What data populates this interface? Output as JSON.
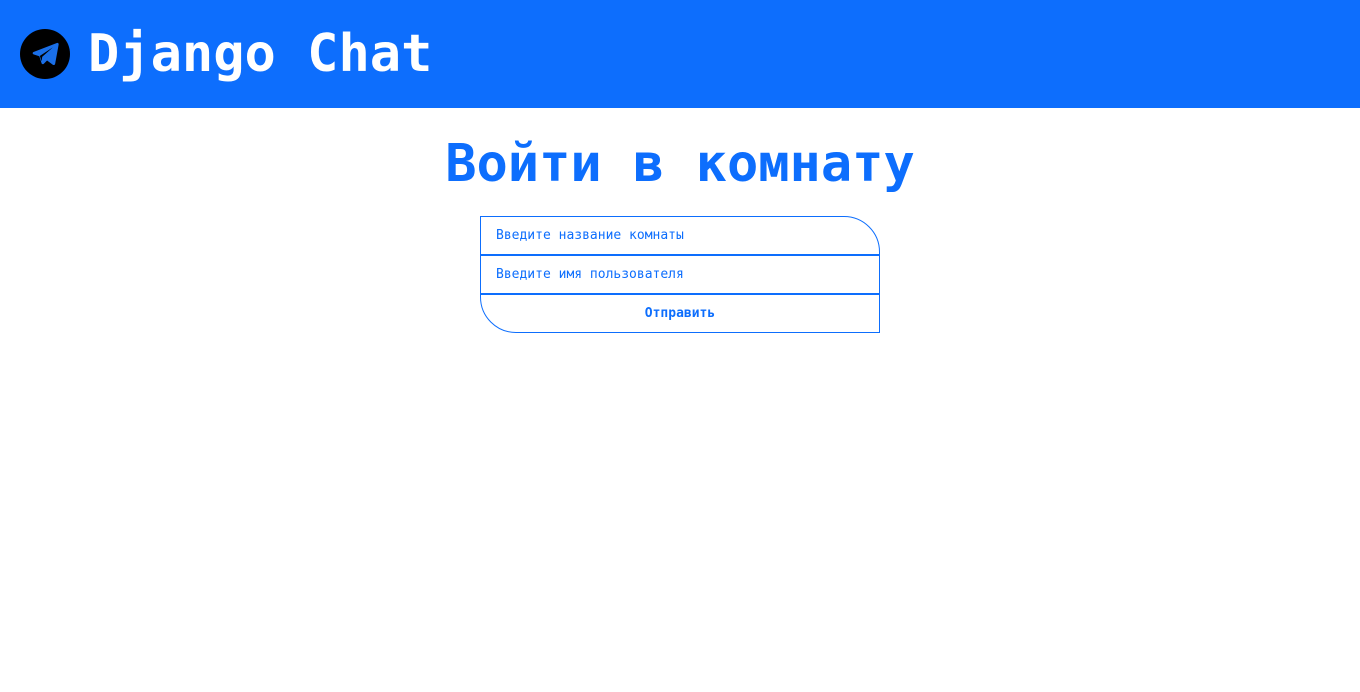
{
  "header": {
    "app_title": "Django Chat",
    "logo_icon": "telegram-send-icon",
    "background_color": "#0d6efd"
  },
  "main": {
    "page_title": "Войти в комнату",
    "form": {
      "room_placeholder": "Введите название комнаты",
      "room_value": "",
      "username_placeholder": "Введите имя пользователя",
      "username_value": "",
      "submit_label": "Отправить"
    }
  },
  "colors": {
    "accent": "#0d6efd",
    "background": "#ffffff",
    "logo_circle": "#000000"
  }
}
